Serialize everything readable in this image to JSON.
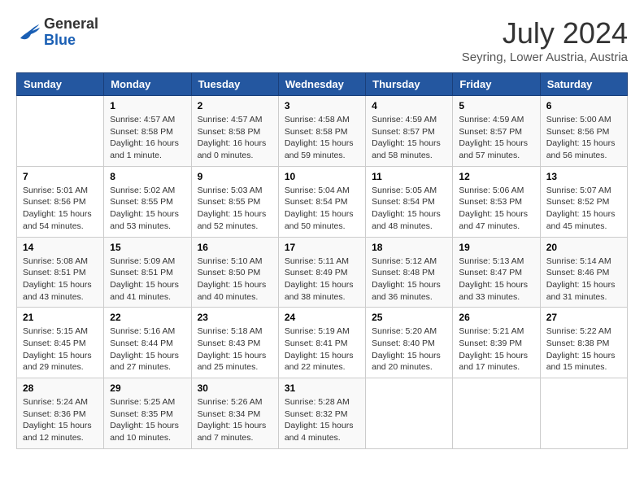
{
  "header": {
    "logo_general": "General",
    "logo_blue": "Blue",
    "month_year": "July 2024",
    "location": "Seyring, Lower Austria, Austria"
  },
  "calendar": {
    "columns": [
      "Sunday",
      "Monday",
      "Tuesday",
      "Wednesday",
      "Thursday",
      "Friday",
      "Saturday"
    ],
    "rows": [
      [
        {
          "day": "",
          "info": ""
        },
        {
          "day": "1",
          "info": "Sunrise: 4:57 AM\nSunset: 8:58 PM\nDaylight: 16 hours\nand 1 minute."
        },
        {
          "day": "2",
          "info": "Sunrise: 4:57 AM\nSunset: 8:58 PM\nDaylight: 16 hours\nand 0 minutes."
        },
        {
          "day": "3",
          "info": "Sunrise: 4:58 AM\nSunset: 8:58 PM\nDaylight: 15 hours\nand 59 minutes."
        },
        {
          "day": "4",
          "info": "Sunrise: 4:59 AM\nSunset: 8:57 PM\nDaylight: 15 hours\nand 58 minutes."
        },
        {
          "day": "5",
          "info": "Sunrise: 4:59 AM\nSunset: 8:57 PM\nDaylight: 15 hours\nand 57 minutes."
        },
        {
          "day": "6",
          "info": "Sunrise: 5:00 AM\nSunset: 8:56 PM\nDaylight: 15 hours\nand 56 minutes."
        }
      ],
      [
        {
          "day": "7",
          "info": "Sunrise: 5:01 AM\nSunset: 8:56 PM\nDaylight: 15 hours\nand 54 minutes."
        },
        {
          "day": "8",
          "info": "Sunrise: 5:02 AM\nSunset: 8:55 PM\nDaylight: 15 hours\nand 53 minutes."
        },
        {
          "day": "9",
          "info": "Sunrise: 5:03 AM\nSunset: 8:55 PM\nDaylight: 15 hours\nand 52 minutes."
        },
        {
          "day": "10",
          "info": "Sunrise: 5:04 AM\nSunset: 8:54 PM\nDaylight: 15 hours\nand 50 minutes."
        },
        {
          "day": "11",
          "info": "Sunrise: 5:05 AM\nSunset: 8:54 PM\nDaylight: 15 hours\nand 48 minutes."
        },
        {
          "day": "12",
          "info": "Sunrise: 5:06 AM\nSunset: 8:53 PM\nDaylight: 15 hours\nand 47 minutes."
        },
        {
          "day": "13",
          "info": "Sunrise: 5:07 AM\nSunset: 8:52 PM\nDaylight: 15 hours\nand 45 minutes."
        }
      ],
      [
        {
          "day": "14",
          "info": "Sunrise: 5:08 AM\nSunset: 8:51 PM\nDaylight: 15 hours\nand 43 minutes."
        },
        {
          "day": "15",
          "info": "Sunrise: 5:09 AM\nSunset: 8:51 PM\nDaylight: 15 hours\nand 41 minutes."
        },
        {
          "day": "16",
          "info": "Sunrise: 5:10 AM\nSunset: 8:50 PM\nDaylight: 15 hours\nand 40 minutes."
        },
        {
          "day": "17",
          "info": "Sunrise: 5:11 AM\nSunset: 8:49 PM\nDaylight: 15 hours\nand 38 minutes."
        },
        {
          "day": "18",
          "info": "Sunrise: 5:12 AM\nSunset: 8:48 PM\nDaylight: 15 hours\nand 36 minutes."
        },
        {
          "day": "19",
          "info": "Sunrise: 5:13 AM\nSunset: 8:47 PM\nDaylight: 15 hours\nand 33 minutes."
        },
        {
          "day": "20",
          "info": "Sunrise: 5:14 AM\nSunset: 8:46 PM\nDaylight: 15 hours\nand 31 minutes."
        }
      ],
      [
        {
          "day": "21",
          "info": "Sunrise: 5:15 AM\nSunset: 8:45 PM\nDaylight: 15 hours\nand 29 minutes."
        },
        {
          "day": "22",
          "info": "Sunrise: 5:16 AM\nSunset: 8:44 PM\nDaylight: 15 hours\nand 27 minutes."
        },
        {
          "day": "23",
          "info": "Sunrise: 5:18 AM\nSunset: 8:43 PM\nDaylight: 15 hours\nand 25 minutes."
        },
        {
          "day": "24",
          "info": "Sunrise: 5:19 AM\nSunset: 8:41 PM\nDaylight: 15 hours\nand 22 minutes."
        },
        {
          "day": "25",
          "info": "Sunrise: 5:20 AM\nSunset: 8:40 PM\nDaylight: 15 hours\nand 20 minutes."
        },
        {
          "day": "26",
          "info": "Sunrise: 5:21 AM\nSunset: 8:39 PM\nDaylight: 15 hours\nand 17 minutes."
        },
        {
          "day": "27",
          "info": "Sunrise: 5:22 AM\nSunset: 8:38 PM\nDaylight: 15 hours\nand 15 minutes."
        }
      ],
      [
        {
          "day": "28",
          "info": "Sunrise: 5:24 AM\nSunset: 8:36 PM\nDaylight: 15 hours\nand 12 minutes."
        },
        {
          "day": "29",
          "info": "Sunrise: 5:25 AM\nSunset: 8:35 PM\nDaylight: 15 hours\nand 10 minutes."
        },
        {
          "day": "30",
          "info": "Sunrise: 5:26 AM\nSunset: 8:34 PM\nDaylight: 15 hours\nand 7 minutes."
        },
        {
          "day": "31",
          "info": "Sunrise: 5:28 AM\nSunset: 8:32 PM\nDaylight: 15 hours\nand 4 minutes."
        },
        {
          "day": "",
          "info": ""
        },
        {
          "day": "",
          "info": ""
        },
        {
          "day": "",
          "info": ""
        }
      ]
    ]
  }
}
